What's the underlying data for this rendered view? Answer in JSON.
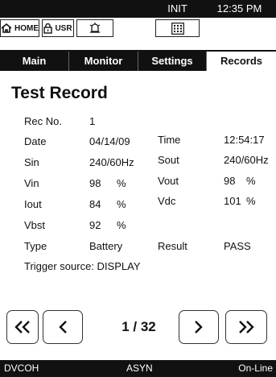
{
  "status": {
    "mode": "INIT",
    "time": "12:35 PM"
  },
  "toolbar": {
    "home_label": "HOME",
    "usr_label": "USR"
  },
  "tabs": [
    {
      "label": "Main"
    },
    {
      "label": "Monitor"
    },
    {
      "label": "Settings"
    },
    {
      "label": "Records",
      "active": true
    }
  ],
  "record": {
    "title": "Test Record",
    "rec_no": {
      "label": "Rec No.",
      "value": "1"
    },
    "date": {
      "label": "Date",
      "value": "04/14/09"
    },
    "sin": {
      "label": "Sin",
      "value": "240/60Hz"
    },
    "vin": {
      "label": "Vin",
      "value": "98",
      "unit": "%"
    },
    "iout": {
      "label": "Iout",
      "value": "84",
      "unit": "%"
    },
    "vbst": {
      "label": "Vbst",
      "value": "92",
      "unit": "%"
    },
    "type": {
      "label": "Type",
      "value": "Battery"
    },
    "time": {
      "label": "Time",
      "value": "12:54:17"
    },
    "sout": {
      "label": "Sout",
      "value": "240/60Hz"
    },
    "vout": {
      "label": "Vout",
      "value": "98",
      "unit": "%"
    },
    "vdc": {
      "label": "Vdc",
      "value": "101",
      "unit": "%"
    },
    "result": {
      "label": "Result",
      "value": "PASS"
    },
    "trigger": "Trigger source:  DISPLAY"
  },
  "pager": {
    "text": "1 / 32"
  },
  "footer": {
    "left": "DVCOH",
    "center": "ASYN",
    "right": "On-Line"
  }
}
